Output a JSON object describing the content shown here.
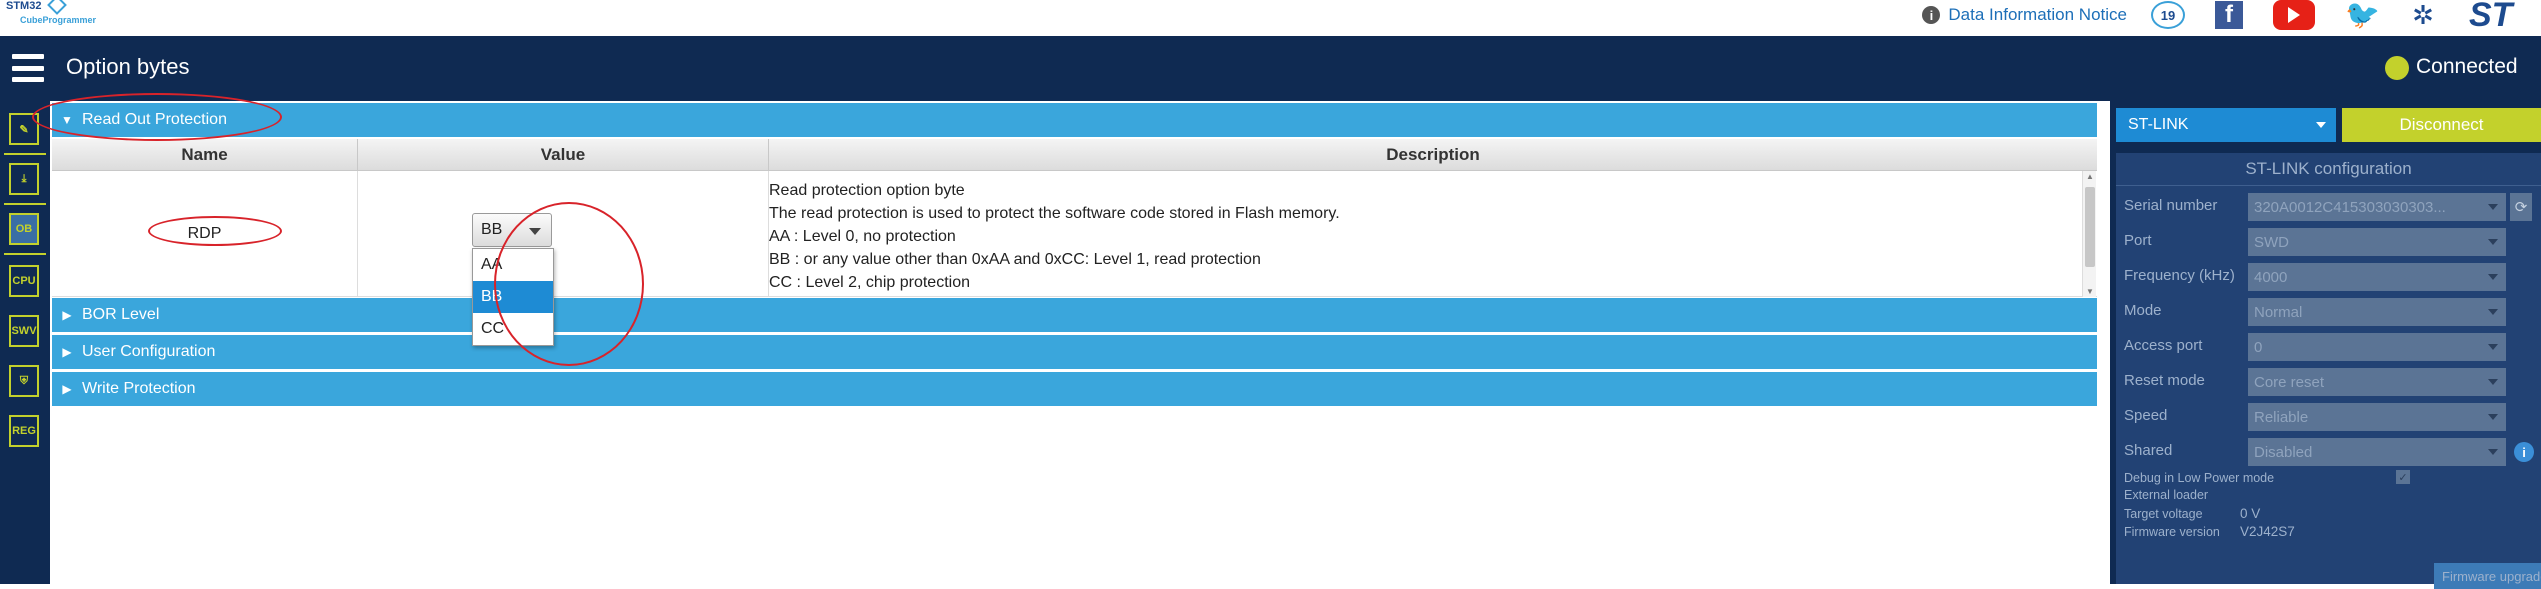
{
  "app": {
    "logo_line1": "STM32",
    "logo_line2": "CubeProgrammer"
  },
  "topbar": {
    "data_notice": "Data Information Notice",
    "badge_text": "19"
  },
  "header": {
    "title": "Option bytes",
    "status": "Connected"
  },
  "sidebar": {
    "items": [
      {
        "label": "✎",
        "name": "edit"
      },
      {
        "label": "⤓",
        "name": "download"
      },
      {
        "label": "OB",
        "name": "ob"
      },
      {
        "label": "CPU",
        "name": "cpu"
      },
      {
        "label": "SWV",
        "name": "swv"
      },
      {
        "label": "⛨",
        "name": "security"
      },
      {
        "label": "REG",
        "name": "reg"
      }
    ]
  },
  "option_bytes": {
    "sections": [
      "Read Out Protection",
      "BOR Level",
      "User Configuration",
      "Write Protection"
    ],
    "columns": [
      "Name",
      "Value",
      "Description"
    ],
    "rdp": {
      "name": "RDP",
      "value": "BB",
      "options": [
        "AA",
        "BB",
        "CC"
      ],
      "description": [
        "Read protection option byte",
        "The read protection is used to protect the software code stored in Flash memory.",
        "AA : Level 0, no protection",
        "BB : or any value other than 0xAA and 0xCC: Level 1, read protection",
        "CC : Level 2, chip protection"
      ]
    }
  },
  "stlink": {
    "selector": "ST-LINK",
    "disconnect": "Disconnect",
    "config_title": "ST-LINK configuration",
    "fields": [
      {
        "label": "Serial number",
        "value": "320A0012C415303030303..."
      },
      {
        "label": "Port",
        "value": "SWD"
      },
      {
        "label": "Frequency (kHz)",
        "value": "4000"
      },
      {
        "label": "Mode",
        "value": "Normal"
      },
      {
        "label": "Access port",
        "value": "0"
      },
      {
        "label": "Reset mode",
        "value": "Core reset"
      },
      {
        "label": "Speed",
        "value": "Reliable"
      },
      {
        "label": "Shared",
        "value": "Disabled"
      }
    ],
    "debug_low_power": "Debug in Low Power mode",
    "external_loader": "External loader",
    "target_voltage_label": "Target voltage",
    "target_voltage": "0 V",
    "firmware_label": "Firmware version",
    "firmware": "V2J42S7",
    "firmware_upgrade": "Firmware upgrade"
  }
}
